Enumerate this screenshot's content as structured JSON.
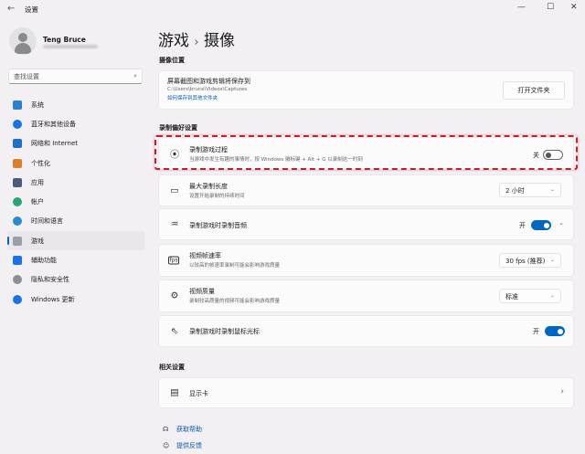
{
  "window": {
    "title": "设置",
    "back": "←",
    "min": "—",
    "max": "☐",
    "close": "✕"
  },
  "profile": {
    "name": "Teng Bruce"
  },
  "search": {
    "placeholder": "查找设置",
    "icon": "search-icon"
  },
  "sidebar": {
    "items": [
      {
        "label": "系统",
        "color": "#2b7fd4"
      },
      {
        "label": "蓝牙和其他设备",
        "color": "#1a73e8"
      },
      {
        "label": "网络和 Internet",
        "color": "#1f6fc8"
      },
      {
        "label": "个性化",
        "color": "#d9822b"
      },
      {
        "label": "应用",
        "color": "#4a5a78"
      },
      {
        "label": "帐户",
        "color": "#2ea37a"
      },
      {
        "label": "时间和语言",
        "color": "#2a8ad4"
      },
      {
        "label": "游戏",
        "color": "#9aa0a8"
      },
      {
        "label": "辅助功能",
        "color": "#1a73e8"
      },
      {
        "label": "隐私和安全性",
        "color": "#8a8f96"
      },
      {
        "label": "Windows 更新",
        "color": "#1a73e8"
      }
    ],
    "selected": 7
  },
  "page": {
    "breadcrumb_parent": "游戏",
    "separator": "›",
    "title": "摄像"
  },
  "capture_location": {
    "section": "摄像位置",
    "title": "屏幕截图和游戏剪辑将保存到",
    "path": "C:\\Users\\bruce\\Videos\\Captures",
    "link": "如何保存到其他文件夹",
    "button": "打开文件夹"
  },
  "prefs": {
    "section": "录制偏好设置",
    "rows": [
      {
        "title": "录制游戏过程",
        "sub": "当游戏中发生有趣的事情时，按 Windows 徽标键 + Alt + G 以录制这一时刻",
        "toggle_label": "关",
        "on": false
      },
      {
        "title": "最大录制长度",
        "sub": "设置开始录制的持续时间",
        "value": "2 小时"
      },
      {
        "title": "录制游戏时录制音频",
        "toggle_label": "开",
        "on": true
      },
      {
        "title": "视频帧速率",
        "sub": "以较高的帧速率录制可能会影响游戏质量",
        "value": "30 fps (推荐)"
      },
      {
        "title": "视频质量",
        "sub": "录制较高质量的视频可能会影响游戏质量",
        "value": "标准"
      },
      {
        "title": "录制游戏时录制鼠标光标",
        "toggle_label": "开",
        "on": true
      }
    ]
  },
  "related": {
    "section": "相关设置",
    "display": "显示卡"
  },
  "links": {
    "help": "获取帮助",
    "feedback": "提供反馈"
  }
}
